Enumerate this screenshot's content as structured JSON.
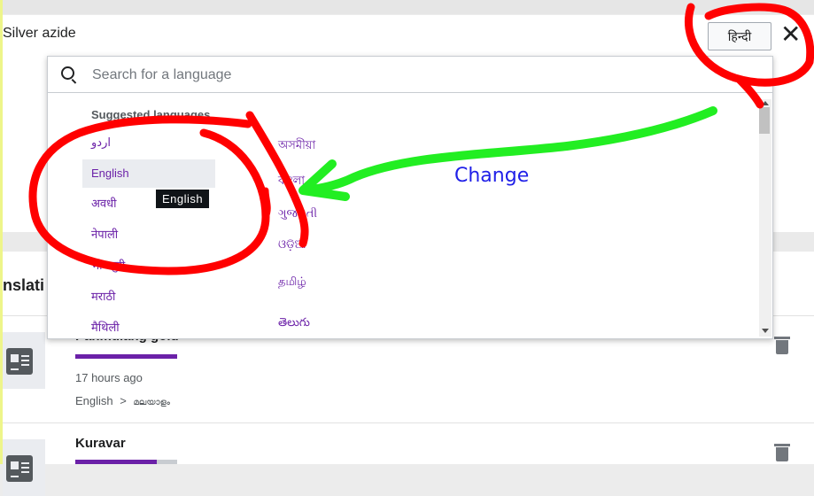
{
  "header": {
    "article_title": "Silver azide",
    "language_button": "हिन्दी",
    "close_glyph": "✕"
  },
  "dropdown": {
    "search_placeholder": "Search for a language",
    "section_heading": "Suggested languages",
    "column1": [
      "اردو",
      "English",
      "अवधी",
      "नेपाली",
      "भोजपुरी",
      "मराठी",
      "मैथिली"
    ],
    "column2": [
      "অসমীয়া",
      "বাংলা",
      "ગુજરાતી",
      "ଓଡ଼ିଆ",
      "தமிழ்",
      "తెలుగు"
    ],
    "tooltip": "English"
  },
  "page": {
    "translations_label": "nslati",
    "cards": [
      {
        "title": "Pahmulang gold",
        "time": "17 hours ago",
        "source_lang": "English",
        "arrow": ">",
        "target_lang": "മലയാളം",
        "progress": 1.0
      },
      {
        "title": "Kuravar",
        "progress": 0.8
      }
    ]
  },
  "annotation": {
    "label": "Change",
    "colors": {
      "red": "#ff0000",
      "green": "#22ee22",
      "blue": "#2020e8"
    }
  },
  "icons": [
    "search-icon",
    "close-icon",
    "article-icon",
    "trash-icon",
    "chevron-right-icon"
  ]
}
